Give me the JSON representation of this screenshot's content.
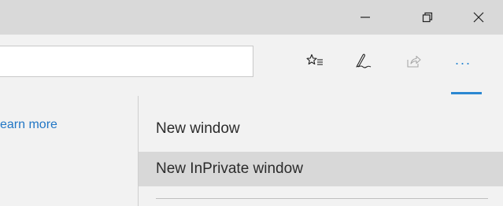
{
  "window_controls": {
    "minimize_icon": "minimize-icon",
    "restore_icon": "restore-icon",
    "close_icon": "close-icon"
  },
  "toolbar": {
    "favorites_icon": "favorites-list-icon",
    "notes_icon": "pen-icon",
    "share_icon": "share-icon",
    "more_label": "···",
    "accent_color": "#2b87d1"
  },
  "page": {
    "link_text": "earn more"
  },
  "menu": {
    "items": [
      {
        "label": "New window"
      },
      {
        "label": "New InPrivate window",
        "highlighted": true
      }
    ]
  },
  "colors": {
    "titlebar": "#d9d9d9",
    "background": "#f2f2f2",
    "highlight": "#d8d8d8",
    "link": "#2176c5"
  }
}
